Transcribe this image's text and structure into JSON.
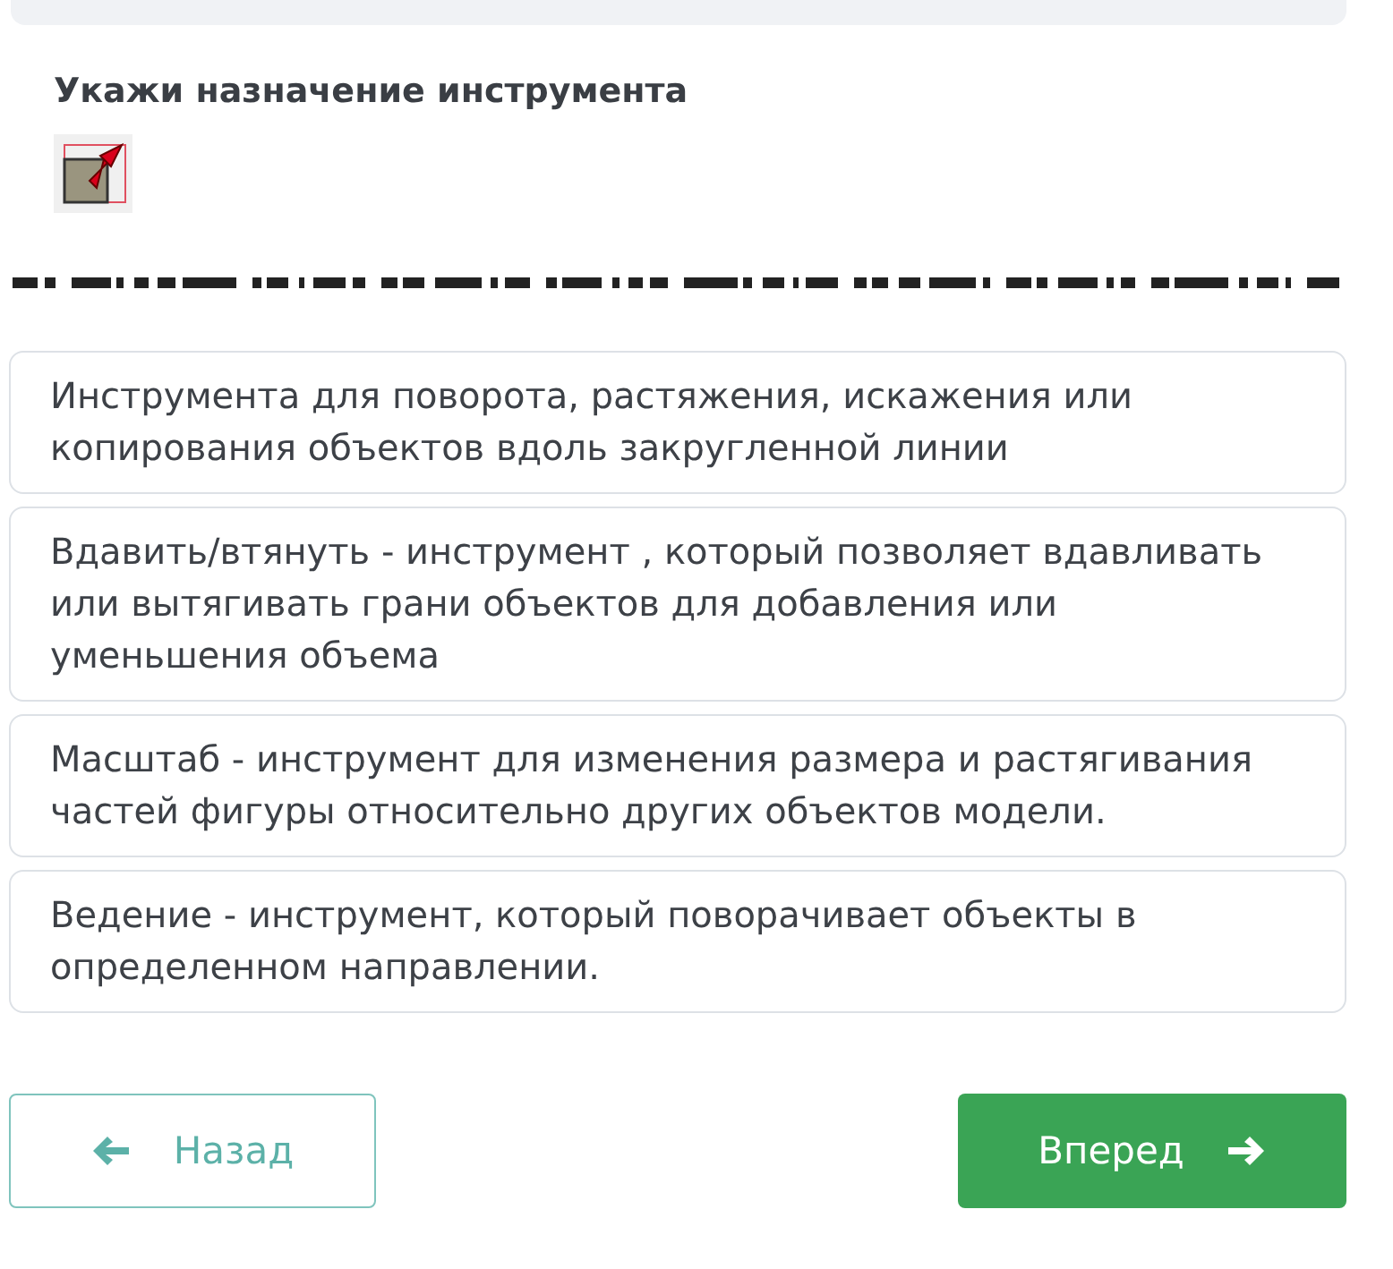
{
  "question": {
    "title": "Укажи назначение инструмента"
  },
  "options": [
    {
      "text": "Инструмента для поворота, растяжения, искажения или копирования объектов вдоль закругленной линии",
      "selected": false
    },
    {
      "text": "Вдавить/втянуть - инструмент , который позволяет вдавливать или вытягивать грани объектов для добавления или уменьшения объема",
      "selected": false
    },
    {
      "text": "Масштаб - инструмент для изменения размера и растягивания частей фигуры относительно других объектов модели.",
      "selected": false
    },
    {
      "text": "Ведение - инструмент, который поворачивает объекты в определенном направлении.",
      "selected": false
    }
  ],
  "buttons": {
    "back": "Назад",
    "next": "Вперед"
  }
}
